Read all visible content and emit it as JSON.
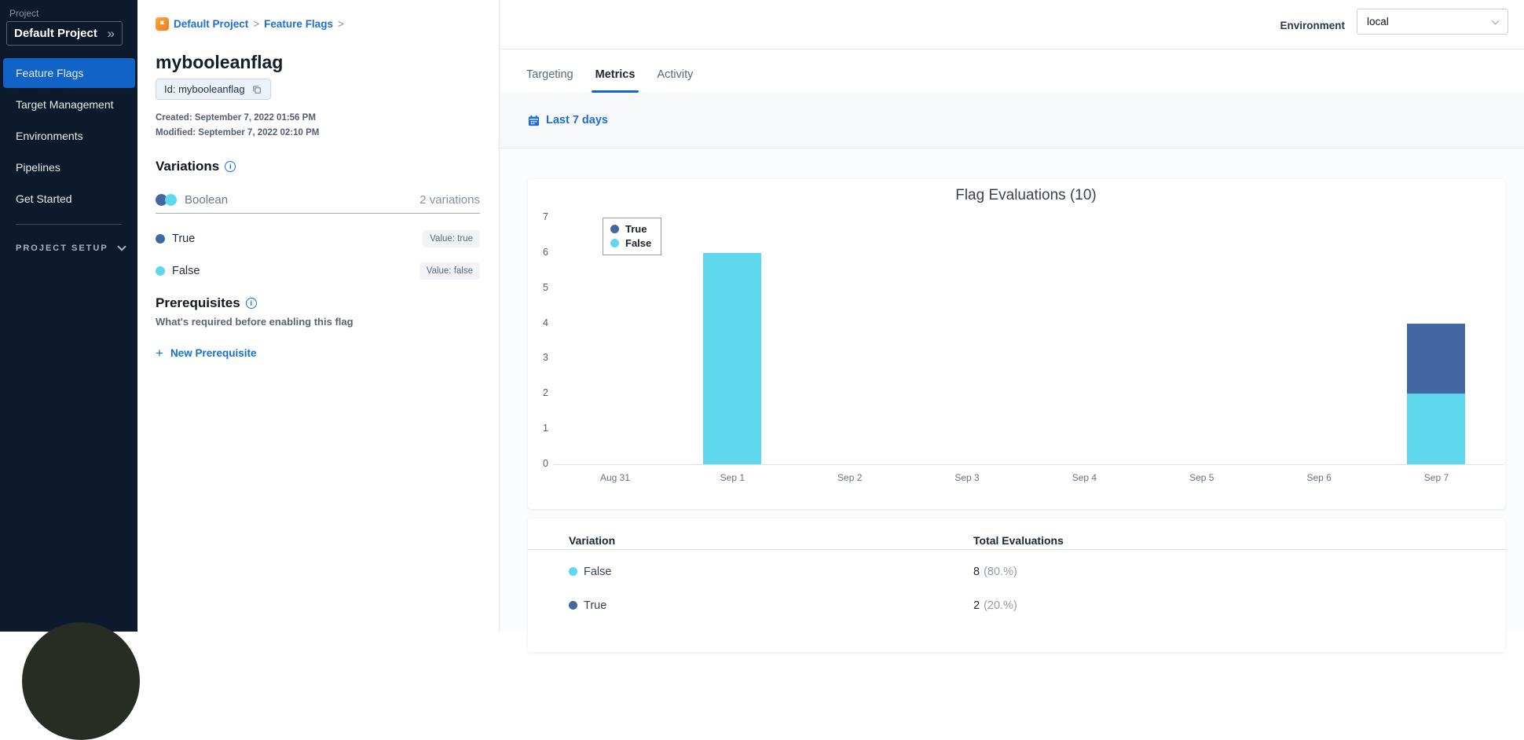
{
  "sidebar": {
    "project_label": "Project",
    "project_name": "Default Project",
    "items": [
      {
        "label": "Feature Flags",
        "active": true
      },
      {
        "label": "Target Management",
        "active": false
      },
      {
        "label": "Environments",
        "active": false
      },
      {
        "label": "Pipelines",
        "active": false
      },
      {
        "label": "Get Started",
        "active": false
      }
    ],
    "setup_label": "PROJECT SETUP"
  },
  "flag": {
    "breadcrumb": {
      "project": "Default Project",
      "section": "Feature Flags"
    },
    "title": "mybooleanflag",
    "id_label": "Id: mybooleanflag",
    "created": "Created: September 7, 2022 01:56 PM",
    "modified": "Modified: September 7, 2022 02:10 PM",
    "variations": {
      "heading": "Variations",
      "type_label": "Boolean",
      "count_label": "2 variations",
      "items": [
        {
          "name": "True",
          "value_label": "Value: true",
          "color": "#4267a3"
        },
        {
          "name": "False",
          "value_label": "Value: false",
          "color": "#5fd8ee"
        }
      ]
    },
    "prerequisites": {
      "heading": "Prerequisites",
      "subtitle": "What's required before enabling this flag",
      "add_label": "New Prerequisite"
    }
  },
  "metrics": {
    "environment_label": "Environment",
    "environment_value": "local",
    "tabs": [
      {
        "label": "Targeting",
        "active": false
      },
      {
        "label": "Metrics",
        "active": true
      },
      {
        "label": "Activity",
        "active": false
      }
    ],
    "date_range_label": "Last 7 days",
    "table": {
      "headers": [
        "Variation",
        "Total Evaluations"
      ],
      "rows": [
        {
          "name": "False",
          "color": "#5fd8ee",
          "count": "8",
          "percent": "(80.%)"
        },
        {
          "name": "True",
          "color": "#4267a3",
          "count": "2",
          "percent": "(20.%)"
        }
      ]
    }
  },
  "chart_data": {
    "type": "bar",
    "stacked": true,
    "title": "Flag Evaluations (10)",
    "total_evaluations": 10,
    "categories": [
      "Aug 31",
      "Sep 1",
      "Sep 2",
      "Sep 3",
      "Sep 4",
      "Sep 5",
      "Sep 6",
      "Sep 7"
    ],
    "series": [
      {
        "name": "True",
        "color": "#4267a3",
        "values": [
          0,
          0,
          0,
          0,
          0,
          0,
          0,
          2
        ]
      },
      {
        "name": "False",
        "color": "#5fd8ee",
        "values": [
          0,
          6,
          0,
          0,
          0,
          0,
          0,
          2
        ]
      }
    ],
    "ylim": [
      0,
      7
    ],
    "yticks": [
      0,
      1,
      2,
      3,
      4,
      5,
      6,
      7
    ],
    "legend_position": "top-left",
    "grid": false
  },
  "colors": {
    "accent_blue": "#1465c8",
    "link_blue": "#1d6fd2",
    "sidebar_bg": "#0c1a2b",
    "series_true": "#4267a3",
    "series_false": "#5fd8ee"
  }
}
